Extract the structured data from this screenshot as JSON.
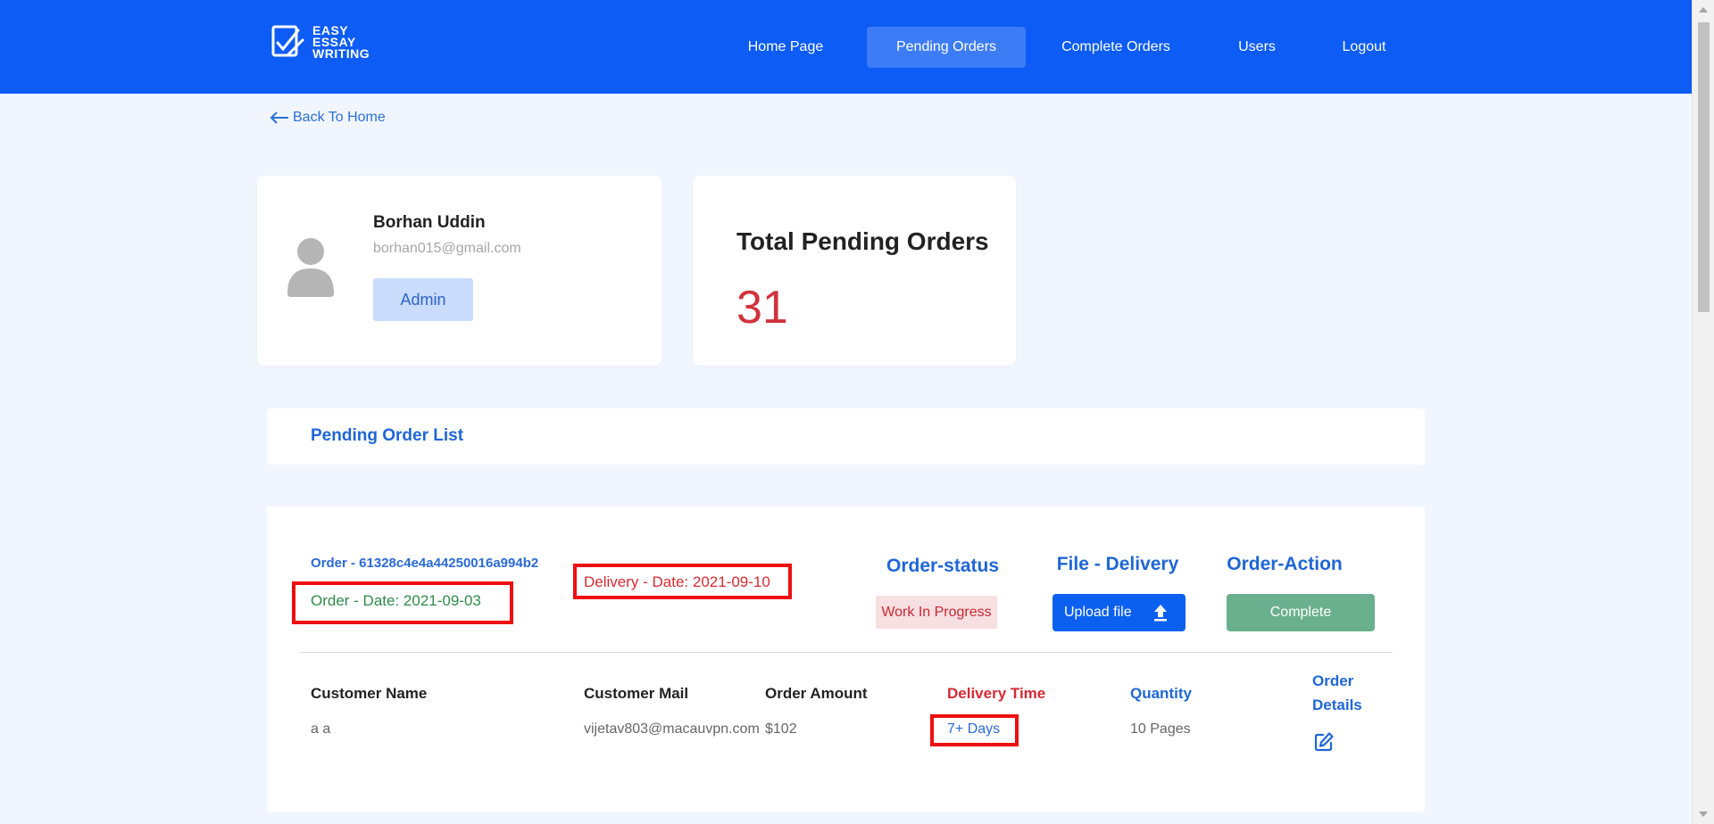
{
  "header": {
    "logo_lines": [
      "EASY",
      "ESSAY",
      "WRITING"
    ],
    "nav": [
      "Home Page",
      "Pending Orders",
      "Complete Orders",
      "Users",
      "Logout"
    ],
    "active_nav": "Pending Orders",
    "bg_color": "#0c5cf5"
  },
  "back_link": "Back To Home",
  "profile": {
    "name": "Borhan Uddin",
    "email": "borhan015@gmail.com",
    "role": "Admin"
  },
  "stats": {
    "title": "Total Pending Orders",
    "value": "31"
  },
  "list_title": "Pending Order List",
  "order": {
    "id_label": "Order - 61328c4e4a44250016a994b2",
    "order_date": "Order - Date: 2021-09-03",
    "delivery_date": "Delivery - Date: 2021-09-10",
    "status_heading": "Order-status",
    "status": "Work In Progress",
    "file_heading": "File - Delivery",
    "upload_label": "Upload file",
    "action_heading": "Order-Action",
    "action_label": "Complete",
    "table": {
      "headers": {
        "name": "Customer Name",
        "mail": "Customer Mail",
        "amount": "Order Amount",
        "time": "Delivery Time",
        "quantity": "Quantity",
        "details_line1": "Order",
        "details_line2": "Details"
      },
      "row": {
        "name": "a a",
        "mail": "vijetav803@macauvpn.com",
        "amount": "$102",
        "time": "7+ Days",
        "quantity": "10 Pages"
      }
    }
  },
  "icons": {
    "logo": "checklist-logo-icon",
    "back": "arrow-left-icon",
    "avatar": "user-avatar-icon",
    "upload": "upload-icon",
    "edit": "edit-icon"
  }
}
